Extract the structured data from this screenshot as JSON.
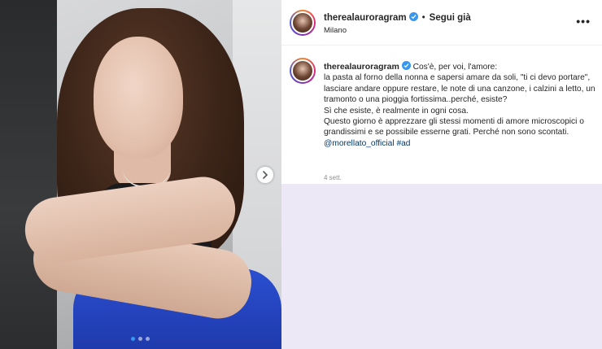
{
  "post": {
    "username": "therealauroragram",
    "follow_label": "Segui già",
    "location": "Milano",
    "more_label": "•••"
  },
  "caption": {
    "username": "therealauroragram",
    "lines": [
      "Cos'è, per voi, l'amore:",
      "la pasta al forno della nonna e sapersi amare da soli, \"ti ci devo portare\", lasciare andare oppure restare, le note di una canzone, i calzini a letto, un tramonto o una pioggia fortissima..perché, esiste?",
      "Sì che esiste, è realmente in ogni cosa.",
      "Questo giorno è apprezzare gli stessi momenti di amore microscopici o grandissimi e se possibile esserne grati. Perché non sono scontati."
    ],
    "mention": "@morellato_official",
    "hashtag": "#ad",
    "time": "4 sett."
  },
  "icons": [
    "verified-badge-icon",
    "chevron-right-icon",
    "more-options-icon"
  ],
  "carousel": {
    "total": 3,
    "current": 1
  },
  "colors": {
    "accent": "#3897f0",
    "tag": "#00376b",
    "blank_area": "#ede8f6"
  }
}
